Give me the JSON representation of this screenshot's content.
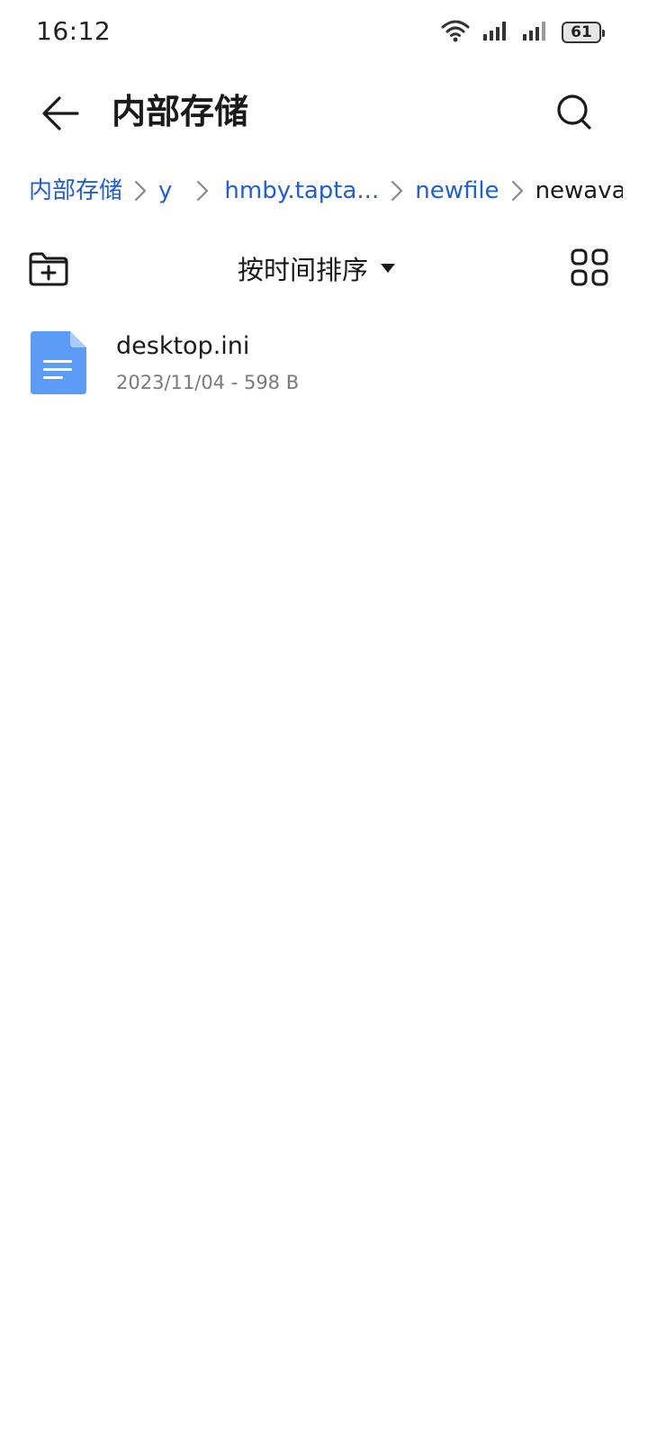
{
  "status_bar": {
    "time": "16:12",
    "battery_level": "61",
    "icons": [
      "wifi-icon",
      "signal-icon",
      "signal-icon",
      "battery-icon"
    ]
  },
  "header": {
    "title": "内部存储",
    "back_icon": "arrow-left-icon",
    "search_icon": "search-icon"
  },
  "breadcrumb": {
    "items": [
      {
        "label": "内部存储"
      },
      {
        "label": "y"
      },
      {
        "label": "hmby.tapta..."
      },
      {
        "label": "newfile"
      },
      {
        "label": "newavatar"
      }
    ]
  },
  "toolbar": {
    "new_folder_icon": "folder-add-icon",
    "sort_label": "按时间排序",
    "sort_icon": "caret-down-icon",
    "view_icon": "grid-view-icon"
  },
  "files": [
    {
      "name": "desktop.ini",
      "meta": "2023/11/04 - 598 B",
      "icon": "document-icon"
    }
  ],
  "colors": {
    "accent": "#1e5fd6",
    "file_icon": "#5b9cf6",
    "text_primary": "#1a1a1a",
    "text_secondary": "#7a7a7a",
    "background": "#ffffff"
  }
}
